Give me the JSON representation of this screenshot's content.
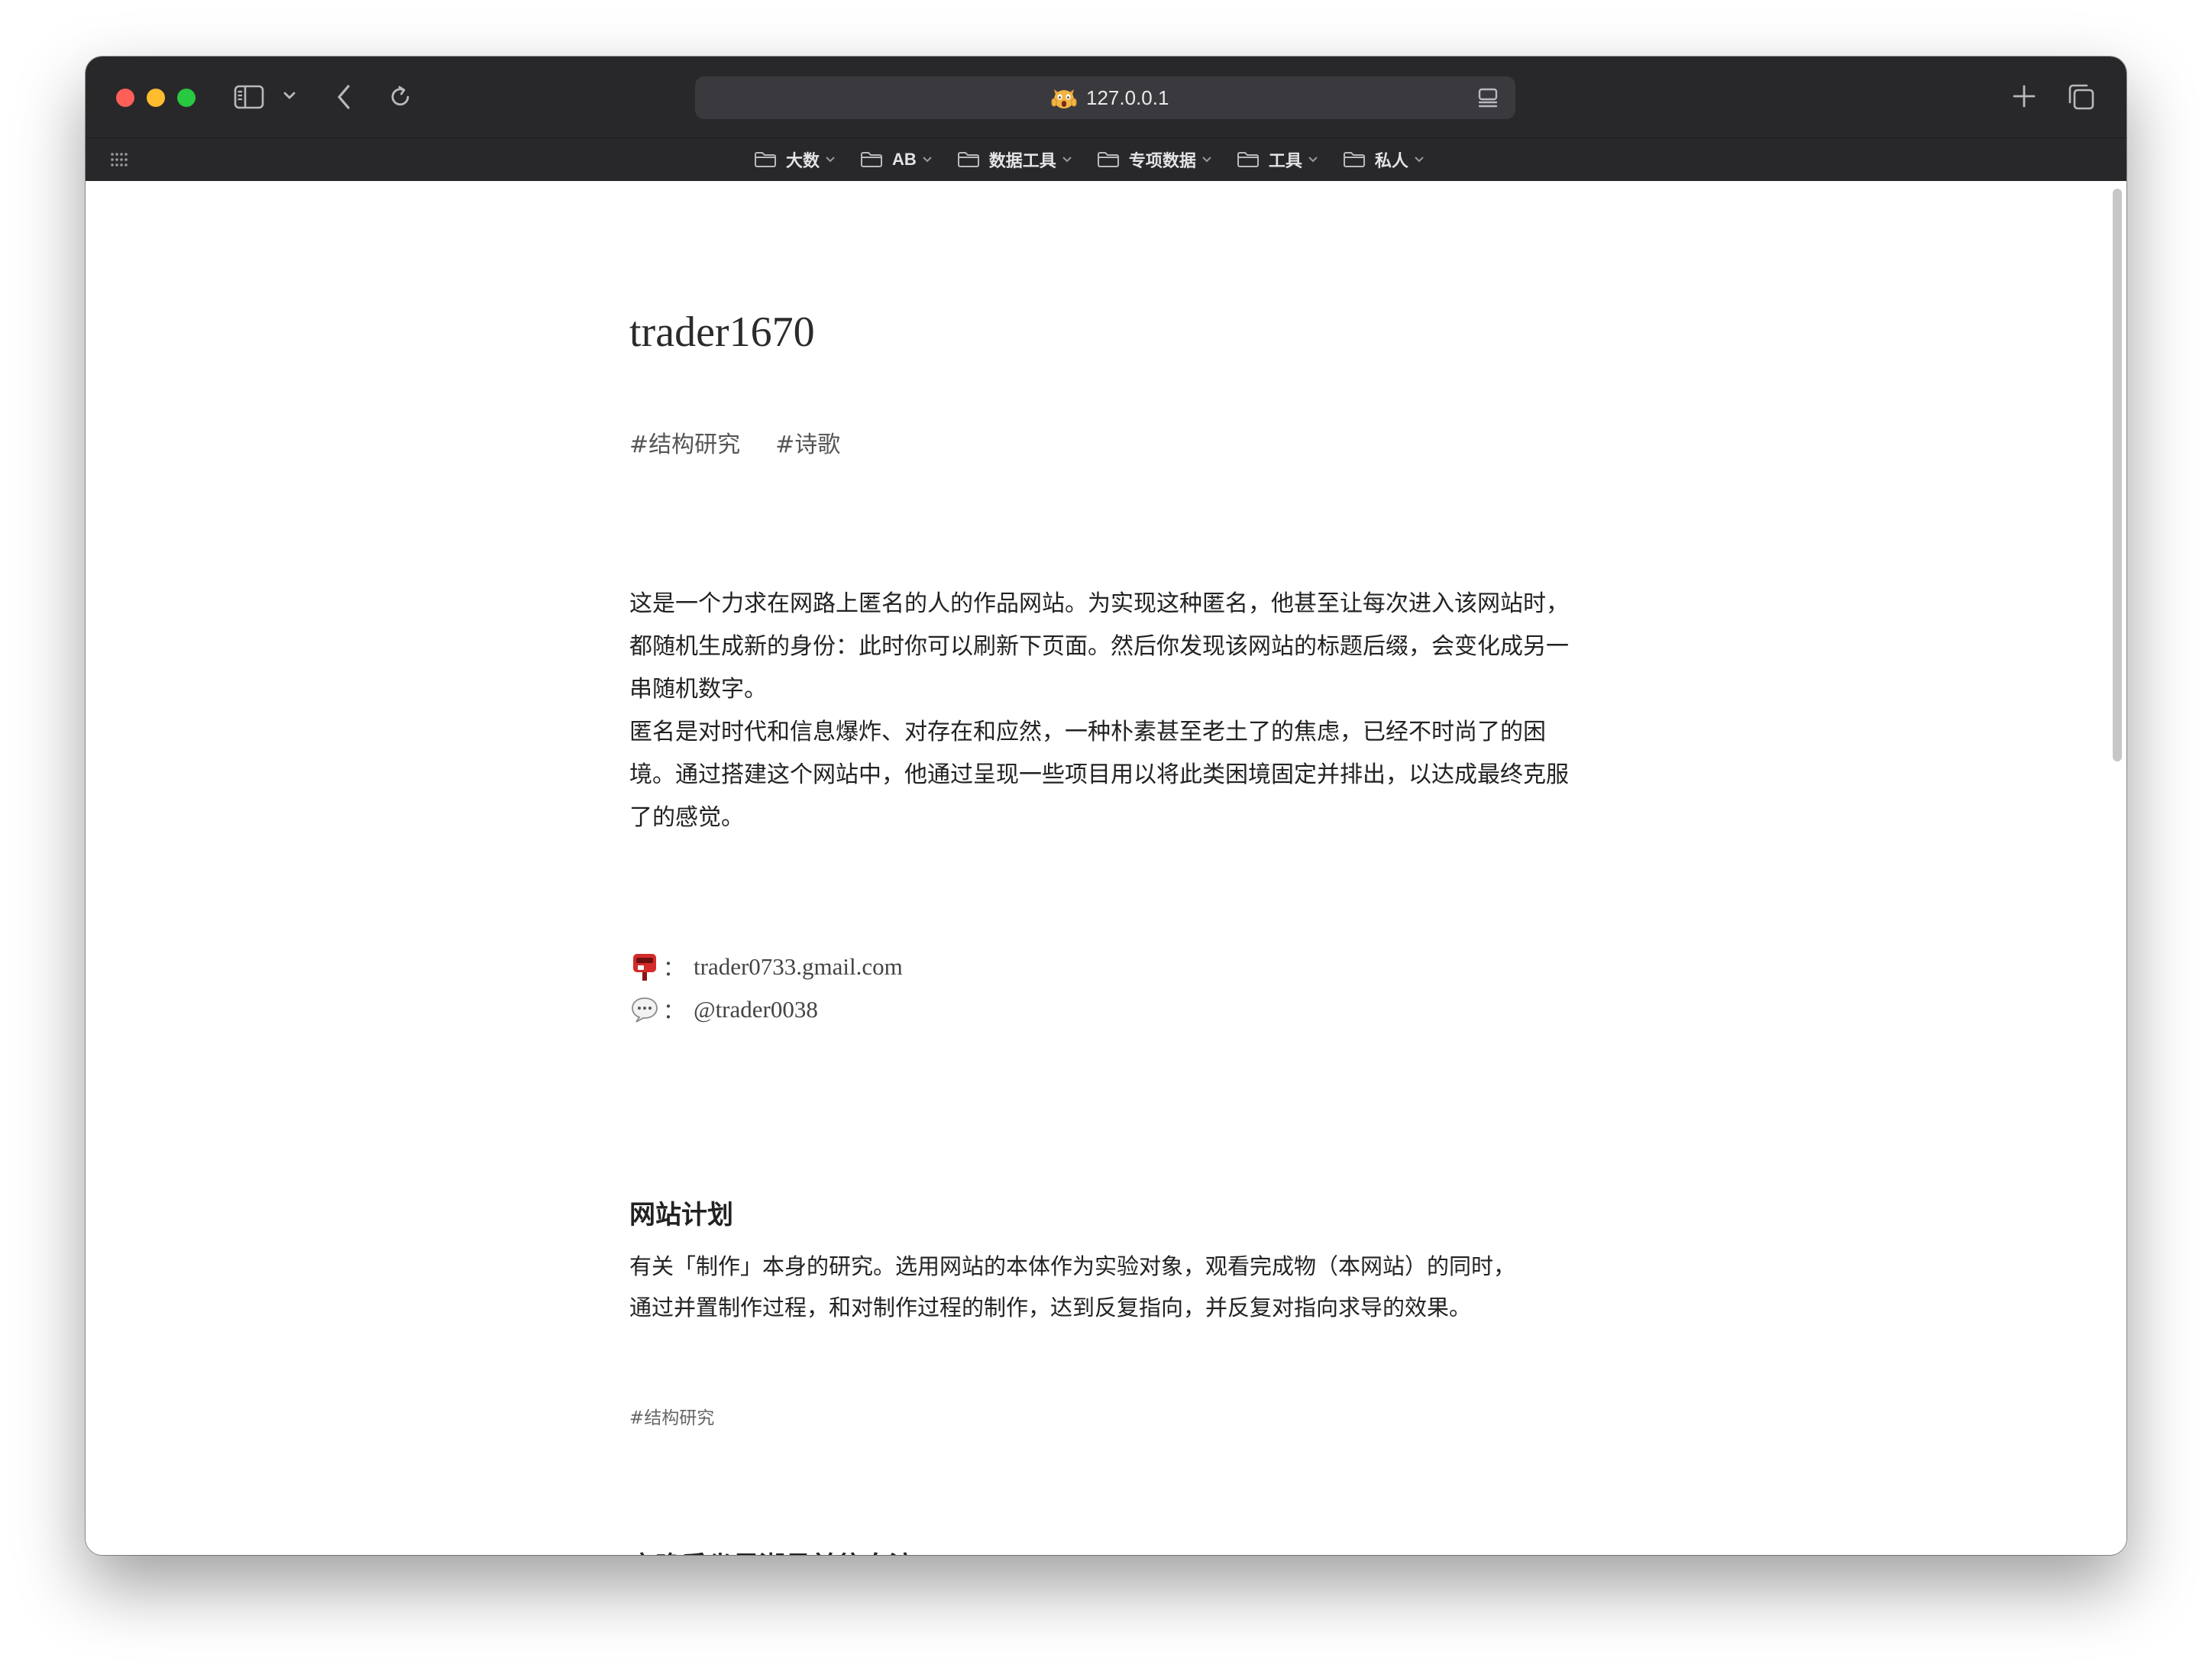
{
  "browser": {
    "url": "127.0.0.1",
    "favicon": "screaming-cat-emoji"
  },
  "bookmarks": [
    {
      "label": "大数"
    },
    {
      "label": "AB"
    },
    {
      "label": "数据工具"
    },
    {
      "label": "专项数据"
    },
    {
      "label": "工具"
    },
    {
      "label": "私人"
    }
  ],
  "page": {
    "title": "trader1670",
    "tags": [
      "#结构研究",
      "#诗歌"
    ],
    "intro": [
      "这是一个力求在网路上匿名的人的作品网站。为实现这种匿名，他甚至让每次进入该网站时，都随机生成新的身份：此时你可以刷新下页面。然后你发现该网站的标题后缀，会变化成另一串随机数字。",
      "匿名是对时代和信息爆炸、对存在和应然，一种朴素甚至老土了的焦虑，已经不时尚了的困境。通过搭建这个网站中，他通过呈现一些项目用以将此类困境固定并排出，以达成最终克服了的感觉。"
    ],
    "contacts": [
      {
        "icon": "postbox-icon",
        "colon": "：",
        "value": "trader0733.gmail.com"
      },
      {
        "icon": "speech-bubble-icon",
        "colon": "：",
        "value": "@trader0038"
      }
    ],
    "projects": [
      {
        "title": "网站计划",
        "desc": [
          "有关「制作」本身的研究。选用网站的本体作为实验对象，观看完成物（本网站）的同时，",
          "通过并置制作过程，和对制作过程的制作，达到反复指向，并反复对指向求导的效果。"
        ],
        "tag": "#结构研究"
      },
      {
        "title": "夜晚乘坐黑潮号前往白滨"
      }
    ]
  }
}
